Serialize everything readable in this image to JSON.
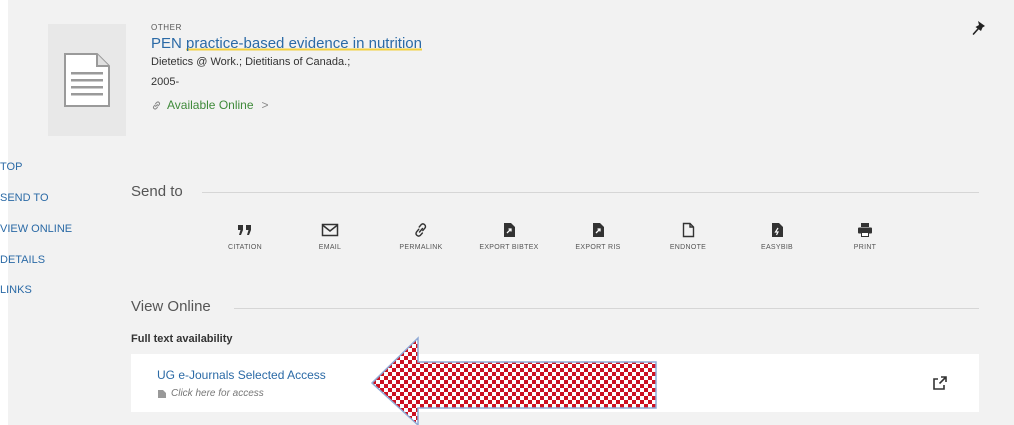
{
  "record": {
    "type": "OTHER",
    "title_part1": "PEN ",
    "title_part2": "practice-based evidence in nutrition",
    "author": "Dietetics @ Work.; Dietitians of Canada.;",
    "date": "2005-",
    "availability": "Available Online",
    "availability_chevron": ">",
    "thumbnail_icon": "document-icon",
    "pin_icon": "pushpin-icon"
  },
  "nav": {
    "items": [
      {
        "label": "TOP"
      },
      {
        "label": "SEND TO"
      },
      {
        "label": "VIEW ONLINE"
      },
      {
        "label": "DETAILS"
      },
      {
        "label": "LINKS"
      }
    ]
  },
  "send_to": {
    "title": "Send to",
    "actions": [
      {
        "label": "CITATION",
        "icon": "quote-icon"
      },
      {
        "label": "EMAIL",
        "icon": "envelope-icon"
      },
      {
        "label": "PERMALINK",
        "icon": "link-icon"
      },
      {
        "label": "EXPORT BIBTEX",
        "icon": "export-file-icon"
      },
      {
        "label": "EXPORT RIS",
        "icon": "export-file-icon"
      },
      {
        "label": "ENDNOTE",
        "icon": "document-outline-icon"
      },
      {
        "label": "EASYBIB",
        "icon": "easybib-icon"
      },
      {
        "label": "PRINT",
        "icon": "printer-icon"
      }
    ]
  },
  "view_online": {
    "title": "View Online",
    "full_text_label": "Full text availability",
    "link_title": "UG e-Journals Selected Access",
    "link_subtitle": "Click here for access",
    "external_icon": "external-link-icon"
  },
  "colors": {
    "link": "#2b6aa6",
    "available": "#3f8a3a",
    "highlight": "#f3d03e",
    "arrow_red": "#cc1122"
  }
}
